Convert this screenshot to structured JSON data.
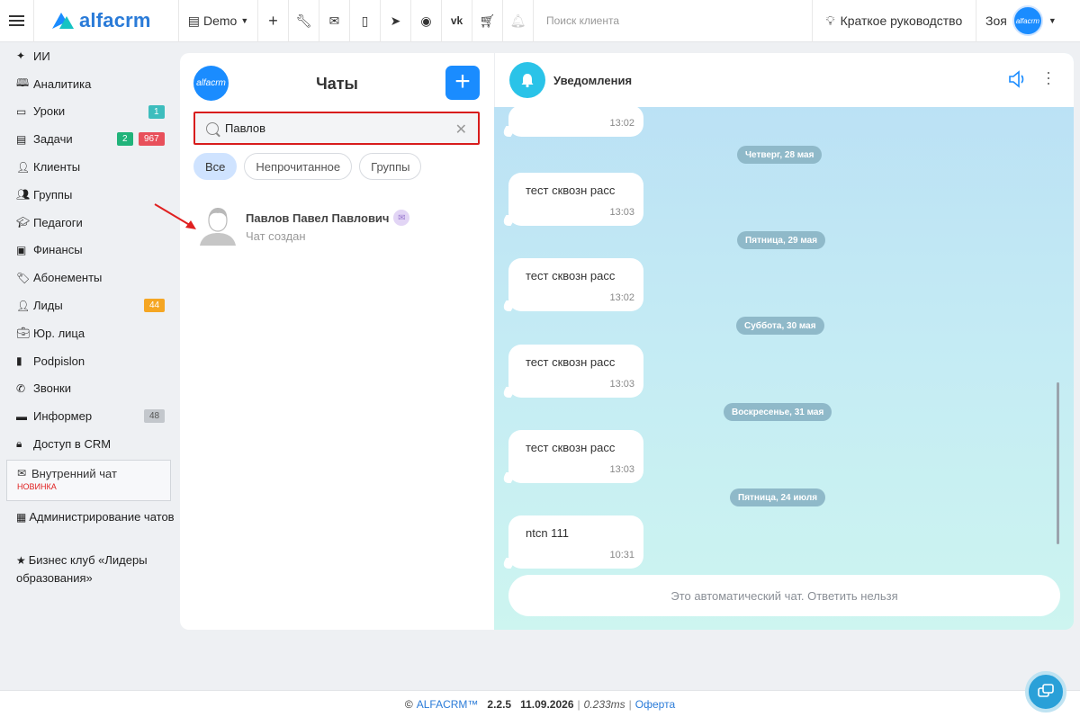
{
  "topbar": {
    "logo_text": "alfacrm",
    "branch": "Demo",
    "search_placeholder": "Поиск клиента",
    "guide_label": "Краткое руководство",
    "user_name": "Зоя",
    "avatar_text": "alfacrm"
  },
  "sidebar": {
    "items": [
      {
        "label": "ИИ",
        "icon": "sparkles-icon"
      },
      {
        "label": "Аналитика",
        "icon": "book-icon"
      },
      {
        "label": "Уроки",
        "icon": "calendar-icon",
        "badges": [
          "1"
        ]
      },
      {
        "label": "Задачи",
        "icon": "clipboard-icon",
        "badges": [
          "2",
          "967"
        ]
      },
      {
        "label": "Клиенты",
        "icon": "user-icon"
      },
      {
        "label": "Группы",
        "icon": "users-icon"
      },
      {
        "label": "Педагоги",
        "icon": "graduation-cap-icon"
      },
      {
        "label": "Финансы",
        "icon": "money-icon"
      },
      {
        "label": "Абонементы",
        "icon": "tag-icon"
      },
      {
        "label": "Лиды",
        "icon": "user-plus-icon",
        "badges": [
          "44"
        ]
      },
      {
        "label": "Юр. лица",
        "icon": "briefcase-icon"
      },
      {
        "label": "Podpislon",
        "icon": "file-icon"
      },
      {
        "label": "Звонки",
        "icon": "phone-icon"
      },
      {
        "label": "Информер",
        "icon": "informer-icon",
        "badges": [
          "48"
        ]
      },
      {
        "label": "Доступ в CRM",
        "icon": "lock-icon"
      }
    ],
    "active": {
      "label": "Внутренний чат",
      "tag": "НОВИНКА"
    },
    "admin_chats": "Администрирование чатов",
    "biz_club": "Бизнес клуб «Лидеры образования»"
  },
  "chats": {
    "logo_text": "alfacrm",
    "title": "Чаты",
    "search_value": "Павлов",
    "filters": [
      "Все",
      "Непрочитанное",
      "Группы"
    ],
    "result": {
      "name": "Павлов Павел Павлович",
      "status": "Чат создан"
    }
  },
  "messages": {
    "title": "Уведомления",
    "items": [
      {
        "text": "",
        "time": "13:02"
      },
      {
        "date": "Четверг, 28 мая"
      },
      {
        "text": "тест сквозн расс",
        "time": "13:03"
      },
      {
        "date": "Пятница, 29 мая"
      },
      {
        "text": "тест сквозн расс",
        "time": "13:02"
      },
      {
        "date": "Суббота, 30 мая"
      },
      {
        "text": "тест сквозн расс",
        "time": "13:03"
      },
      {
        "date": "Воскресенье, 31 мая"
      },
      {
        "text": "тест сквозн расс",
        "time": "13:03"
      },
      {
        "date": "Пятница, 24 июля"
      },
      {
        "text": "ntcn 111",
        "time": "10:31"
      }
    ],
    "autoreply": "Это автоматический чат. Ответить нельзя"
  },
  "footer": {
    "copyright": "©",
    "brand": "ALFACRM™",
    "version": "2.2.5",
    "date": "11.09.2026",
    "timing": "0.233ms",
    "sep": "|",
    "offer": "Оферта"
  },
  "colors": {
    "accent": "#1a8cff",
    "danger": "#d81c1c"
  }
}
